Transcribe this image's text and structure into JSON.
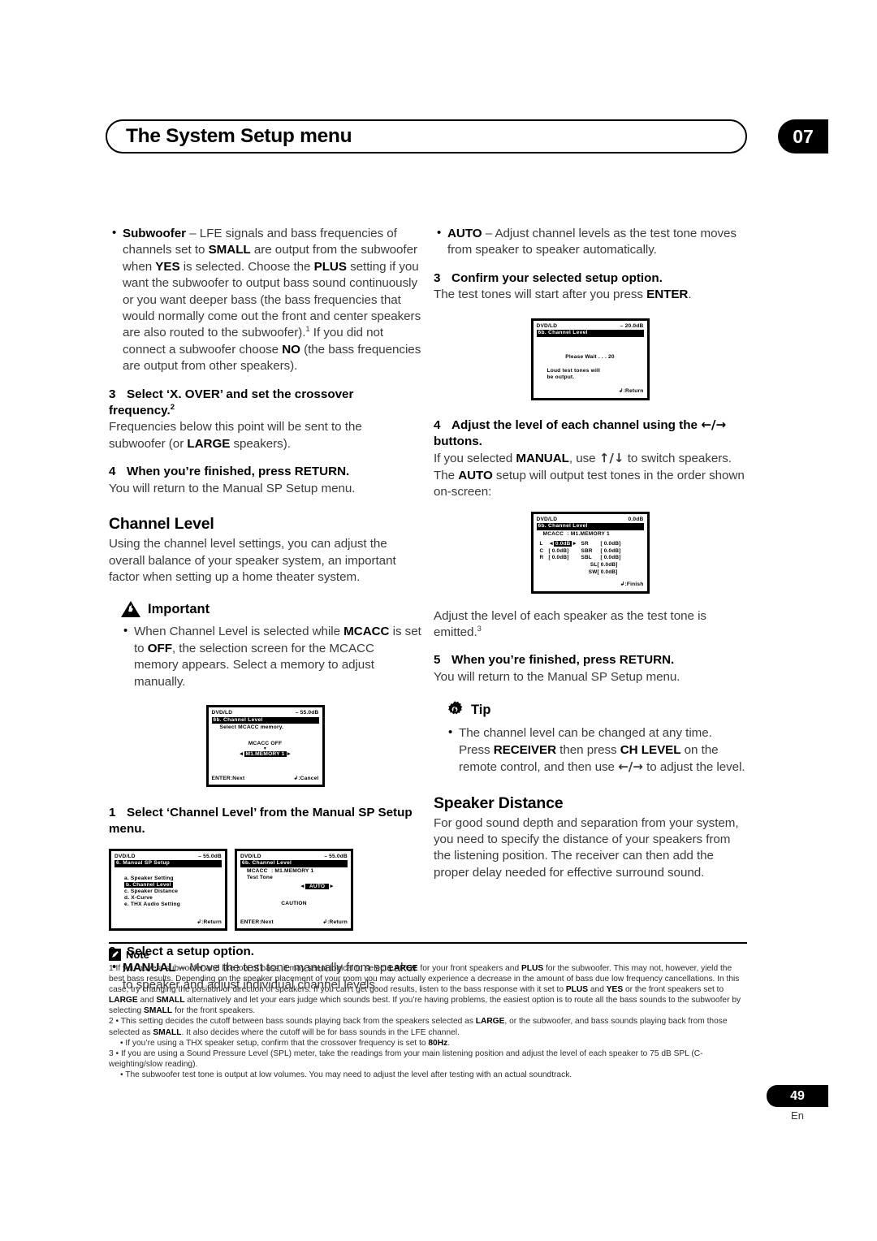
{
  "header": {
    "title": "The System Setup menu",
    "chapter": "07"
  },
  "left_column": {
    "subwoofer_bullet": {
      "term": "Subwoofer",
      "text_1": " – LFE signals and bass frequencies of channels set to ",
      "b1": "SMALL",
      "text_2": " are output from the subwoofer when ",
      "b2": "YES",
      "text_3": " is selected. Choose the ",
      "b3": "PLUS",
      "text_4": " setting if you want the subwoofer to output bass sound continuously or you want deeper bass (the bass frequencies that would normally come out the front and center speakers are also routed to the subwoofer).",
      "sup": "1",
      "text_5": " If you did not connect a subwoofer choose ",
      "b4": "NO",
      "text_6": " (the bass frequencies are output from other speakers)."
    },
    "step3": {
      "num": "3",
      "title": "Select ‘X. OVER’ and set the crossover frequency.",
      "sup": "2",
      "body_1": "Frequencies below this point will be sent to the subwoofer (or ",
      "b1": "LARGE",
      "body_2": " speakers)."
    },
    "step4": {
      "num": "4",
      "title": "When you’re finished, press RETURN.",
      "body": "You will return to the Manual SP Setup menu."
    },
    "channel_level": {
      "heading": "Channel Level",
      "body": "Using the channel level settings, you can adjust the overall balance of your speaker system, an important factor when setting up a home theater system."
    },
    "important": {
      "label": "Important",
      "bullet_1": "When Channel Level is selected while ",
      "b1": "MCACC",
      "bullet_2": " is set to ",
      "b2": "OFF",
      "bullet_3": ", the selection screen for the MCACC memory appears. Select a memory to adjust manually."
    },
    "step1": {
      "num": "1",
      "title": "Select ‘Channel Level’ from the Manual SP Setup menu."
    },
    "step2": {
      "num": "2",
      "title": "Select a setup option.",
      "bullet_term": "MANUAL",
      "bullet_text": " – Move the test tone manually from speaker to speaker and adjust individual channel levels."
    }
  },
  "right_column": {
    "auto_bullet": {
      "term": "AUTO",
      "text": " – Adjust channel levels as the test tone moves from speaker to speaker automatically."
    },
    "step3": {
      "num": "3",
      "title": "Confirm your selected setup option.",
      "body_1": "The test tones will start after you press ",
      "b1": "ENTER",
      "body_2": "."
    },
    "step4": {
      "num": "4",
      "title_1": "Adjust the level of each channel using the ",
      "arrows": "←/→",
      "title_2": " buttons.",
      "body_1": "If you selected ",
      "b1": "MANUAL",
      "body_2": ", use ",
      "arrows_ud": "↑/↓",
      "body_3": " to switch speakers. The ",
      "b2": "AUTO",
      "body_4": " setup will output test tones in the order shown on-screen:"
    },
    "after_osd": {
      "body": "Adjust the level of each speaker as the test tone is emitted.",
      "sup": "3"
    },
    "step5": {
      "num": "5",
      "title": "When you’re finished, press RETURN.",
      "body": "You will return to the Manual SP Setup menu."
    },
    "tip": {
      "label": "Tip",
      "bullet_1": "The channel level can be changed at any time. Press ",
      "b1": "RECEIVER",
      "bullet_2": " then press ",
      "b2": "CH LEVEL",
      "bullet_3": " on the remote control, and then use ",
      "arrows": "←/→",
      "bullet_4": " to adjust the level."
    },
    "speaker_distance": {
      "heading": "Speaker Distance",
      "body": "For good sound depth and separation from your system, you need to specify the distance of your speakers from the listening position. The receiver can then add the proper delay needed for effective surround sound."
    }
  },
  "osd_screens": {
    "mcacc_memory": {
      "source": "DVD/LD",
      "volume": "– 55.0dB",
      "title": "6b. Channel Level",
      "line1": "Select MCACC memory.",
      "line2": "MCACC OFF",
      "down_marker": "▼",
      "selection": "M1.MEMORY 1",
      "left_arrow": "◄",
      "right_arrow": "►",
      "foot_left": "ENTER:Next",
      "foot_right": ":Cancel"
    },
    "manual_sp_setup": {
      "source": "DVD/LD",
      "volume": "– 55.0dB",
      "title": "6. Manual SP Setup",
      "items": [
        "a. Speaker Setting",
        "b. Channel Level",
        "c. Speaker Distance",
        "d. X-Curve",
        "e. THX Audio Setting"
      ],
      "selected_index": 1,
      "foot_right": ":Return"
    },
    "test_tone": {
      "source": "DVD/LD",
      "volume": "– 55.0dB",
      "title": "6b. Channel Level",
      "mcacc_label": "MCACC",
      "mcacc_value": ": M1.MEMORY 1",
      "test_tone_label": "Test Tone",
      "selection": "AUTO",
      "left_arrow": "◄",
      "right_arrow": "►",
      "caution": "CAUTION",
      "foot_left": "ENTER:Next",
      "foot_right": ":Return"
    },
    "please_wait": {
      "source": "DVD/LD",
      "volume": "– 20.0dB",
      "title": "6b. Channel Level",
      "line1": "Please Wait . . . 20",
      "line2": "Loud test tones will",
      "line3": "be output.",
      "foot_right": ":Return"
    },
    "channel_level_adjust": {
      "source": "DVD/LD",
      "volume": "0.0dB",
      "title": "6b. Channel Level",
      "mcacc_label": "MCACC",
      "mcacc_value": ": M1.MEMORY 1",
      "left_arrow": "◄",
      "right_arrow": "►",
      "rows": [
        {
          "ch": "L",
          "val": "0.0dB",
          "highlight": true,
          "ch2": "SR",
          "val2": "[   0.0dB]"
        },
        {
          "ch": "C",
          "val": "[  0.0dB]",
          "highlight": false,
          "ch2": "SBR",
          "val2": "[   0.0dB]"
        },
        {
          "ch": "R",
          "val": "[  0.0dB]",
          "highlight": false,
          "ch2": "SBL",
          "val2": "[   0.0dB]"
        },
        {
          "ch": "",
          "val": "",
          "highlight": false,
          "ch2": "SL",
          "val2": "[   0.0dB]"
        },
        {
          "ch": "",
          "val": "",
          "highlight": false,
          "ch2": "SW",
          "val2": "[   0.0dB]"
        }
      ],
      "foot_right": ":Finish"
    }
  },
  "notes": {
    "label": "Note",
    "note_1": {
      "num": "1",
      "p1": "If you have a subwoofer and like lots of bass, it may seem logical to select ",
      "b1": "LARGE",
      "p2": " for your front speakers and ",
      "b2": "PLUS",
      "p3": " for the subwoofer. This may not, however, yield the best bass results. Depending on the speaker placement of your room you may actually experience a decrease in the amount of bass due low frequency cancellations. In this case, try changing the position or direction of speakers. If you can’t get good results, listen to the bass response with it set to ",
      "b3": "PLUS",
      "p4": " and ",
      "b4": "YES",
      "p5": " or the front speakers set to ",
      "b5": "LARGE",
      "p6": " and ",
      "b6": "SMALL",
      "p7": " alternatively and let your ears judge which sounds best. If you’re having problems, the easiest option is to route all the bass sounds to the subwoofer by selecting ",
      "b7": "SMALL",
      "p8": " for the front speakers."
    },
    "note_2": {
      "num": "2",
      "bullet": "•",
      "p1": "This setting decides the cutoff between bass sounds playing back from the speakers selected as ",
      "b1": "LARGE",
      "p2": ", or the subwoofer, and bass sounds playing back from those selected as ",
      "b2": "SMALL",
      "p3": ". It also decides where the cutoff will be for bass sounds in the LFE channel.",
      "sub_bullet_1": "If you’re using a THX speaker setup, confirm that the crossover frequency is set to ",
      "sub_b1": "80Hz",
      "sub_p1": "."
    },
    "note_3": {
      "num": "3",
      "bullet": "•",
      "p1": "If you are using a Sound Pressure Level (SPL) meter, take the readings from your main listening position and adjust the level of each speaker to 75 dB SPL (C-weighting/slow reading).",
      "sub_bullet_1": "The subwoofer test tone is output at low volumes. You may need to adjust the level after testing with an actual soundtrack."
    }
  },
  "footer": {
    "page_number": "49",
    "language": "En"
  }
}
